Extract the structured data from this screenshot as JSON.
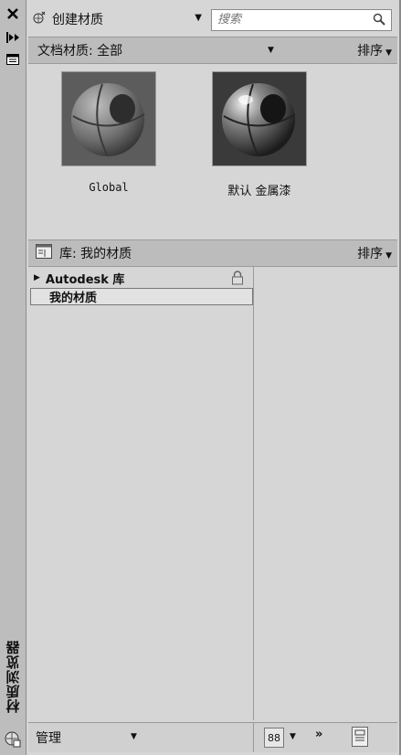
{
  "sidebar": {
    "title": "材质浏览器",
    "close_icon": "close-icon",
    "pin_icon": "autohide-icon",
    "properties_icon": "properties-icon"
  },
  "toolbar": {
    "create_label": "创建材质",
    "search_placeholder": "搜索"
  },
  "doc_section": {
    "title": "文档材质: 全部",
    "sort_label": "排序"
  },
  "materials": [
    {
      "name": "Global"
    },
    {
      "name": "默认 金属漆"
    }
  ],
  "library_section": {
    "title": "库: 我的材质",
    "sort_label": "排序"
  },
  "tree": {
    "autodesk_label": "Autodesk 库",
    "my_materials_label": "我的材质"
  },
  "bottom": {
    "manage_label": "管理",
    "view_label": "88",
    "more_label": "»"
  }
}
